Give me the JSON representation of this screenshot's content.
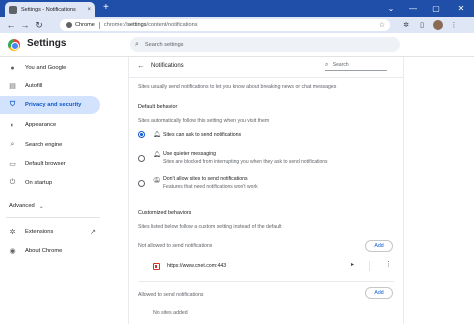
{
  "browser": {
    "tab_title": "Settings - Notifications",
    "tab_close": "×",
    "new_tab": "+",
    "omnibox": {
      "chrome_label": "Chrome",
      "url_prefix": "chrome://",
      "url_host": "settings",
      "url_path": "/content/notifications"
    }
  },
  "header": {
    "title": "Settings",
    "search_placeholder": "Search settings"
  },
  "sidebar": {
    "items": [
      {
        "label": "You and Google",
        "icon": "person-icon"
      },
      {
        "label": "Autofill",
        "icon": "clipboard-icon"
      },
      {
        "label": "Privacy and security",
        "icon": "shield-icon",
        "active": true
      },
      {
        "label": "Appearance",
        "icon": "palette-icon"
      },
      {
        "label": "Search engine",
        "icon": "search-icon"
      },
      {
        "label": "Default browser",
        "icon": "browser-icon"
      },
      {
        "label": "On startup",
        "icon": "power-icon"
      }
    ],
    "advanced": "Advanced",
    "extensions": "Extensions",
    "about": "About Chrome"
  },
  "content": {
    "section_title": "Notifications",
    "search_placeholder": "Search",
    "intro": "Sites usually send notifications to let you know about breaking news or chat messages",
    "default_behavior": {
      "heading": "Default behavior",
      "subtext": "Sites automatically follow this setting when you visit them",
      "options": [
        {
          "label": "Sites can ask to send notifications",
          "sub": "",
          "checked": true
        },
        {
          "label": "Use quieter messaging",
          "sub": "Sites are blocked from interrupting you when they ask to send notifications",
          "checked": false
        },
        {
          "label": "Don't allow sites to send notifications",
          "sub": "Features that need notifications won't work",
          "checked": false
        }
      ]
    },
    "customized": {
      "heading": "Customized behaviors",
      "subtext": "Sites listed below follow a custom setting instead of the default",
      "not_allowed_label": "Not allowed to send notifications",
      "add_label": "Add",
      "blocked_sites": [
        {
          "url": "https://www.cnet.com:443"
        }
      ],
      "allowed_label": "Allowed to send notifications",
      "allowed_add_label": "Add",
      "no_sites": "No sites added"
    }
  }
}
